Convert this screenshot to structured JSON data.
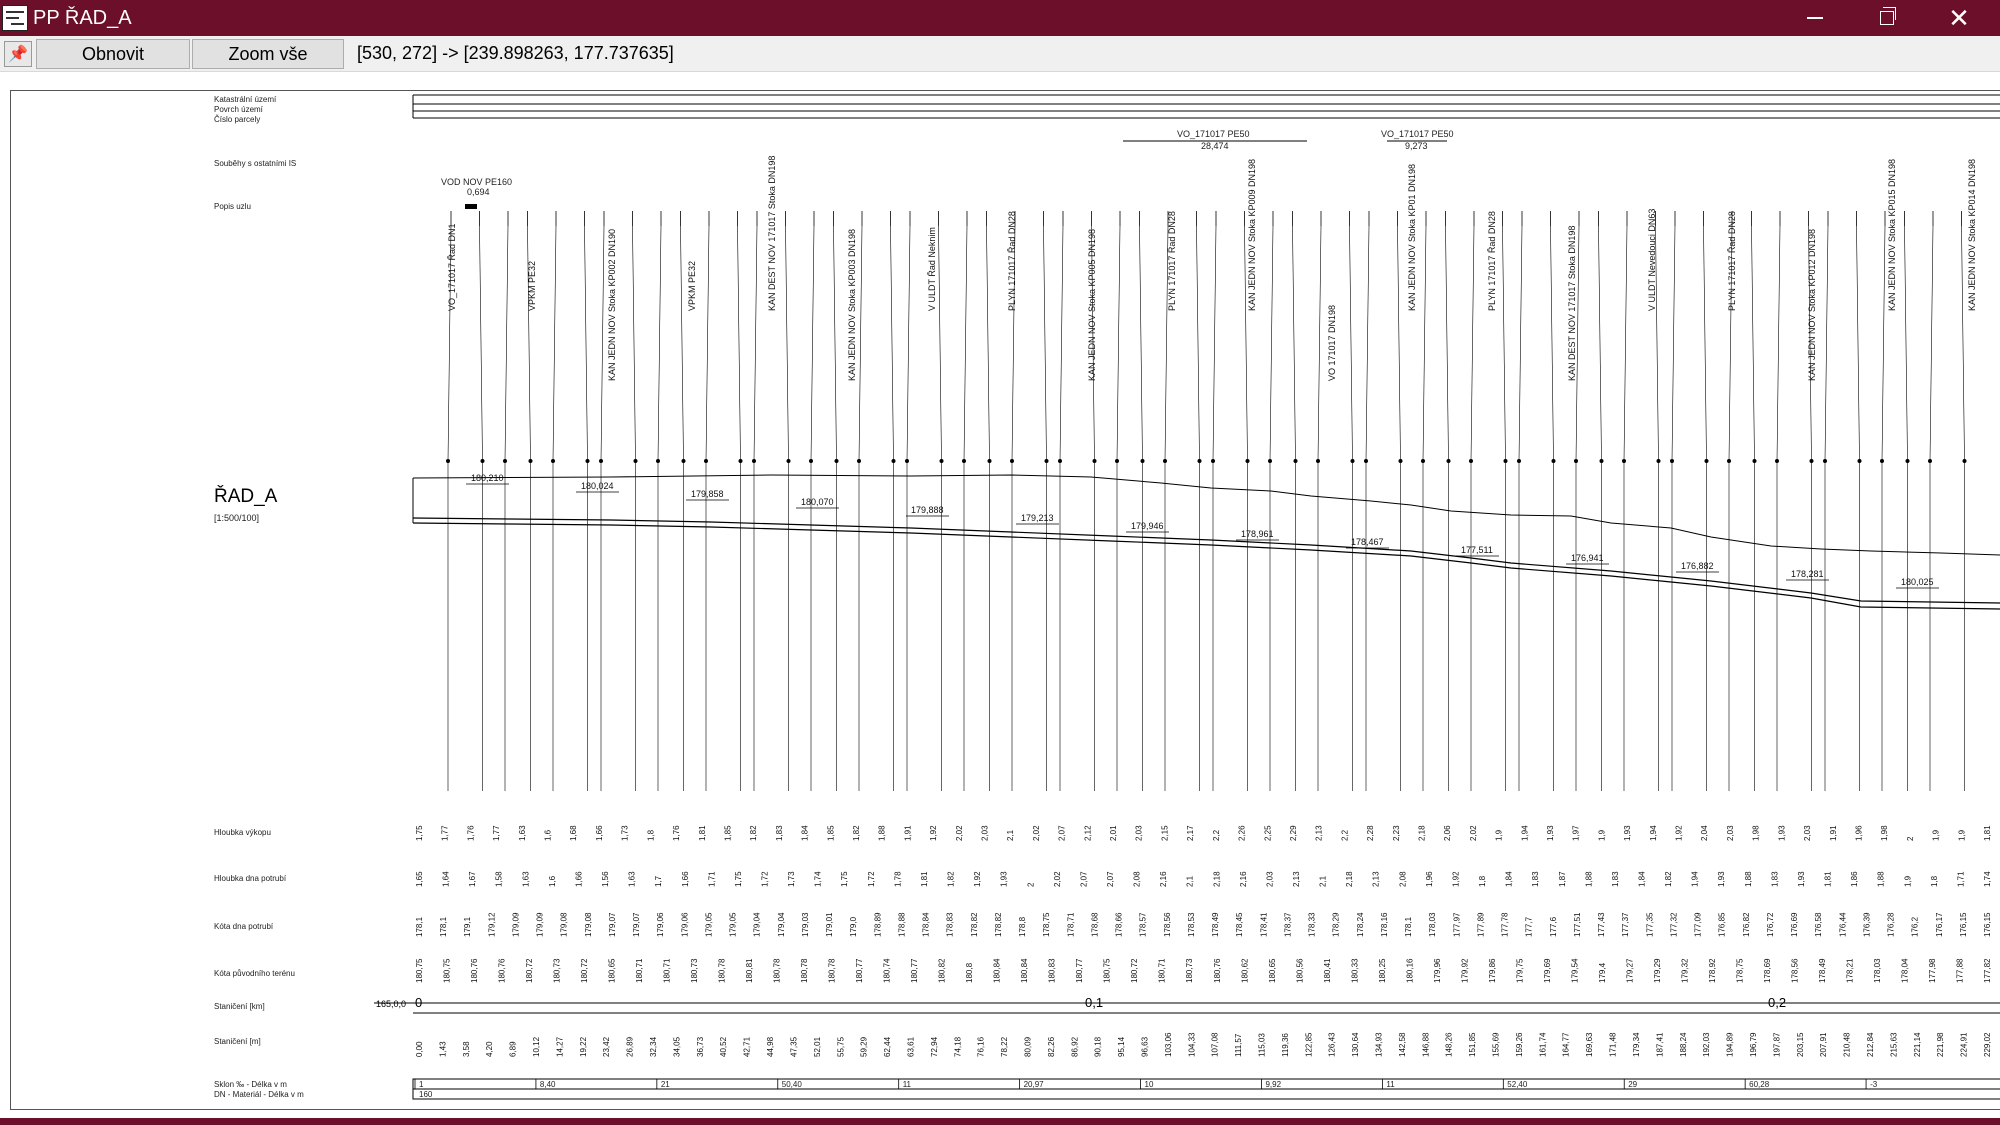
{
  "window": {
    "title": "PP ŘAD_A",
    "app_icon": "profile-chart-icon",
    "controls": {
      "minimize": "minimize-icon",
      "maximize": "restore-icon",
      "close": "close-icon"
    },
    "accent_color": "#6b0f2a"
  },
  "toolbar": {
    "pin_icon": "pin-icon",
    "refresh_label": "Obnovit",
    "zoom_all_label": "Zoom vše",
    "coordinates": "[530, 272] -> [239.898263, 177.737635]"
  },
  "profile": {
    "name": "ŘAD_A",
    "scale": "[1:500/100]",
    "header_rows": [
      "Katastrální území",
      "Povrch území",
      "Číslo parcely"
    ],
    "crossings_label": "Souběhy s ostatními IS",
    "crossings": [
      {
        "label": "VO_171017 PE50",
        "length": "28,474"
      },
      {
        "label": "VO_171017 PE50",
        "length": "9,273"
      }
    ],
    "route_label": "Popis uzlu",
    "route_node": {
      "label": "VOD NOV PE160",
      "value": "0,694"
    },
    "node_labels": [
      "VO_171017 Řad DN1",
      "VPKM PE32",
      "KAN JEDN NOV Stoka KP002 DN190",
      "VPKM PE32",
      "KAN DEST NOV 171017 Stoka DN198",
      "KAN JEDN NOV Stoka KP003 DN198",
      "V ULDT Řad Neknim",
      "PLYN 171017 Řad DN28",
      "KAN JEDN NOV Stoka KP005 DN198",
      "PLYN 171017 Řad DN28",
      "KAN JEDN NOV Stoka KP009 DN198",
      "VO 171017 DN198",
      "KAN JEDN NOV Stoka KP01 DN198",
      "PLYN 171017 Řad DN28",
      "KAN DEST NOV 171017 Stoka DN198",
      "V ULDT Nevedouci DN63",
      "PLYN 171017 Řad DN28",
      "KAN JEDN NOV Stoka KP012 DN198",
      "KAN JEDN NOV Stoka KP015 DN198",
      "KAN JEDN NOV Stoka KP014 DN198"
    ],
    "elevation_labels": [
      "180,210",
      "180,024",
      "179,858",
      "180,070",
      "179,888",
      "179,213",
      "179,946",
      "178,961",
      "178,467",
      "177,511",
      "176,941",
      "176,882",
      "178,281",
      "180,025"
    ],
    "row_labels": [
      "Hloubka výkopu",
      "Hloubka dna potrubí",
      "Kóta dna potrubí",
      "Kóta původního terénu",
      "Staničení [km]",
      "Staničení [m]",
      "Sklon ‰ - Délka v m",
      "DN - Materiál - Délka v m"
    ],
    "station_km_start": "165,0,0",
    "km_marks": [
      "0",
      "0,1",
      "0,2"
    ],
    "depth_values": [
      "1,75",
      "1,77",
      "1,76",
      "1,77",
      "1,63",
      "1,6",
      "1,68",
      "1,66",
      "1,73",
      "1,8",
      "1,76",
      "1,81",
      "1,85",
      "1,82",
      "1,83",
      "1,84",
      "1,85",
      "1,82",
      "1,88",
      "1,91",
      "1,92",
      "2,02",
      "2,03",
      "2,1",
      "2,02",
      "2,07",
      "2,12",
      "2,01",
      "2,03",
      "2,15",
      "2,17",
      "2,2",
      "2,26",
      "2,25",
      "2,29",
      "2,13",
      "2,2",
      "2,28",
      "2,23",
      "2,18",
      "2,06",
      "2,02",
      "1,9",
      "1,94",
      "1,93",
      "1,97",
      "1,9",
      "1,93",
      "1,94",
      "1,92",
      "2,04",
      "2,03",
      "1,98",
      "1,93",
      "2,03",
      "1,91",
      "1,96",
      "1,98",
      "2",
      "1,9",
      "1,9",
      "1,81"
    ],
    "pipe_depth_values": [
      "1,65",
      "1,64",
      "1,67",
      "1,58",
      "1,63",
      "1,6",
      "1,66",
      "1,56",
      "1,63",
      "1,7",
      "1,66",
      "1,71",
      "1,75",
      "1,72",
      "1,73",
      "1,74",
      "1,75",
      "1,72",
      "1,78",
      "1,81",
      "1,82",
      "1,92",
      "1,93",
      "2",
      "2,02",
      "2,07",
      "2,07",
      "2,08",
      "2,16",
      "2,1",
      "2,18",
      "2,16",
      "2,03",
      "2,13",
      "2,1",
      "2,18",
      "2,13",
      "2,08",
      "1,96",
      "1,92",
      "1,8",
      "1,84",
      "1,83",
      "1,87",
      "1,88",
      "1,83",
      "1,84",
      "1,82",
      "1,94",
      "1,93",
      "1,88",
      "1,83",
      "1,93",
      "1,81",
      "1,86",
      "1,88",
      "1,9",
      "1,8",
      "1,71",
      "1,74"
    ],
    "pipe_level_values": [
      "178,1",
      "178,1",
      "179,1",
      "179,12",
      "179,09",
      "179,09",
      "179,08",
      "179,08",
      "179,07",
      "179,07",
      "179,06",
      "179,06",
      "179,05",
      "179,05",
      "179,04",
      "179,04",
      "179,03",
      "179,01",
      "179,0",
      "178,89",
      "178,88",
      "178,84",
      "178,83",
      "178,82",
      "178,82",
      "178,8",
      "178,75",
      "178,71",
      "178,68",
      "178,66",
      "178,57",
      "178,56",
      "178,53",
      "178,49",
      "178,45",
      "178,41",
      "178,37",
      "178,33",
      "178,29",
      "178,24",
      "178,16",
      "178,1",
      "178,03",
      "177,97",
      "177,89",
      "177,78",
      "177,7",
      "177,6",
      "177,51",
      "177,43",
      "177,37",
      "177,35",
      "177,32",
      "177,09",
      "176,85",
      "176,82",
      "176,72",
      "176,69",
      "176,58",
      "176,44",
      "176,39",
      "176,28",
      "176,2",
      "176,17",
      "176,15",
      "176,15"
    ],
    "terrain_level_values": [
      "180,75",
      "180,75",
      "180,76",
      "180,76",
      "180,72",
      "180,73",
      "180,72",
      "180,65",
      "180,71",
      "180,71",
      "180,73",
      "180,78",
      "180,81",
      "180,78",
      "180,78",
      "180,78",
      "180,77",
      "180,74",
      "180,77",
      "180,82",
      "180,8",
      "180,84",
      "180,84",
      "180,83",
      "180,77",
      "180,75",
      "180,72",
      "180,71",
      "180,73",
      "180,76",
      "180,62",
      "180,65",
      "180,56",
      "180,41",
      "180,33",
      "180,25",
      "180,16",
      "179,96",
      "179,92",
      "179,86",
      "179,75",
      "179,69",
      "179,54",
      "179,4",
      "179,27",
      "179,29",
      "179,32",
      "178,92",
      "178,75",
      "178,69",
      "178,56",
      "178,49",
      "178,21",
      "178,03",
      "178,04",
      "177,98",
      "177,88",
      "177,82"
    ],
    "station_m_values": [
      "0,00",
      "1,43",
      "3,58",
      "4,20",
      "6,89",
      "10,12",
      "14,27",
      "19,22",
      "23,42",
      "26,89",
      "32,34",
      "34,05",
      "36,73",
      "40,52",
      "42,71",
      "44,98",
      "47,35",
      "52,01",
      "55,75",
      "59,29",
      "62,44",
      "63,61",
      "72,94",
      "74,18",
      "76,16",
      "78,22",
      "80,09",
      "82,26",
      "86,92",
      "90,18",
      "95,14",
      "96,63",
      "103,06",
      "104,33",
      "107,08",
      "111,57",
      "115,03",
      "119,36",
      "122,85",
      "126,43",
      "130,64",
      "134,93",
      "142,58",
      "146,88",
      "148,26",
      "151,85",
      "155,69",
      "159,26",
      "161,74",
      "164,77",
      "169,63",
      "171,48",
      "179,34",
      "187,41",
      "188,24",
      "192,03",
      "194,89",
      "196,79",
      "197,87",
      "203,15",
      "207,91",
      "210,48",
      "212,84",
      "215,63",
      "221,14",
      "221,98",
      "224,91",
      "229,02"
    ],
    "slope_segments": [
      "1",
      "8,40",
      "21",
      "50,40",
      "11",
      "20,97",
      "10",
      "9,92",
      "11",
      "52,40",
      "29",
      "60,28",
      "-3"
    ],
    "dn_material": [
      "160"
    ]
  }
}
